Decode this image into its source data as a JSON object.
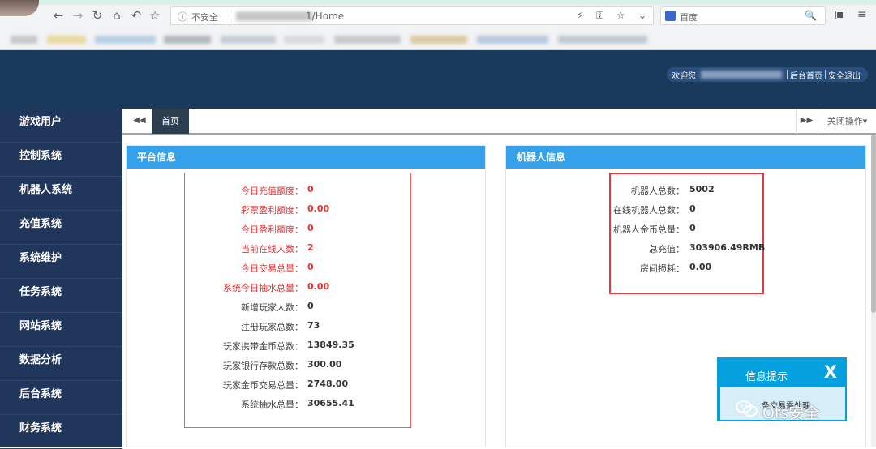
{
  "browser": {
    "security": "不安全",
    "url_suffix": "1/Home",
    "search_engine": "百度"
  },
  "header": {
    "welcome": "欢迎您",
    "home": "后台首页",
    "logout": "安全退出"
  },
  "sidebar": {
    "items": [
      "游戏用户",
      "控制系统",
      "机器人系统",
      "充值系统",
      "系统维护",
      "任务系统",
      "网站系统",
      "数据分析",
      "后台系统",
      "财务系统"
    ]
  },
  "tabs": {
    "home": "首页",
    "close_ops": "关闭操作"
  },
  "platform": {
    "title": "平台信息",
    "rows": [
      {
        "label": "今日充值额度：",
        "value": "0",
        "style": "red"
      },
      {
        "label": "彩票盈利额度：",
        "value": "0.00",
        "style": "red"
      },
      {
        "label": "今日盈利额度：",
        "value": "0",
        "style": "red"
      },
      {
        "label": "当前在线人数：",
        "value": "2",
        "style": "red"
      },
      {
        "label": "今日交易总量：",
        "value": "0",
        "style": "red"
      },
      {
        "label": "系统今日抽水总量：",
        "value": "0.00",
        "style": "red"
      },
      {
        "label": "新增玩家人数：",
        "value": "0",
        "style": "black"
      },
      {
        "label": "注册玩家总数：",
        "value": "73",
        "style": "black"
      },
      {
        "label": "玩家携带金币总数：",
        "value": "13849.35",
        "style": "black"
      },
      {
        "label": "玩家银行存款总数：",
        "value": "300.00",
        "style": "black"
      },
      {
        "label": "玩家金币交易总量：",
        "value": "2748.00",
        "style": "black"
      },
      {
        "label": "系统抽水总量：",
        "value": "30655.41",
        "style": "black"
      }
    ]
  },
  "robot": {
    "title": "机器人信息",
    "rows": [
      {
        "label": "机器人总数：",
        "value": "5002"
      },
      {
        "label": "在线机器人总数：",
        "value": "0"
      },
      {
        "label": "机器人金币总量：",
        "value": "0"
      },
      {
        "label": "总充值：",
        "value": "303906.49RMB"
      },
      {
        "label": "房间损耗：",
        "value": "0.00"
      }
    ]
  },
  "notice": {
    "title": "信息提示",
    "close": "X",
    "text": "条交易需处理"
  },
  "watermark": {
    "text": "Ots安全"
  },
  "colors": {
    "header_bg": "#1a3a5c",
    "sidebar_bg": "#20365a",
    "panel_head": "#35a1eb",
    "red_text": "#e53333",
    "notice_bg": "#05a0de"
  }
}
